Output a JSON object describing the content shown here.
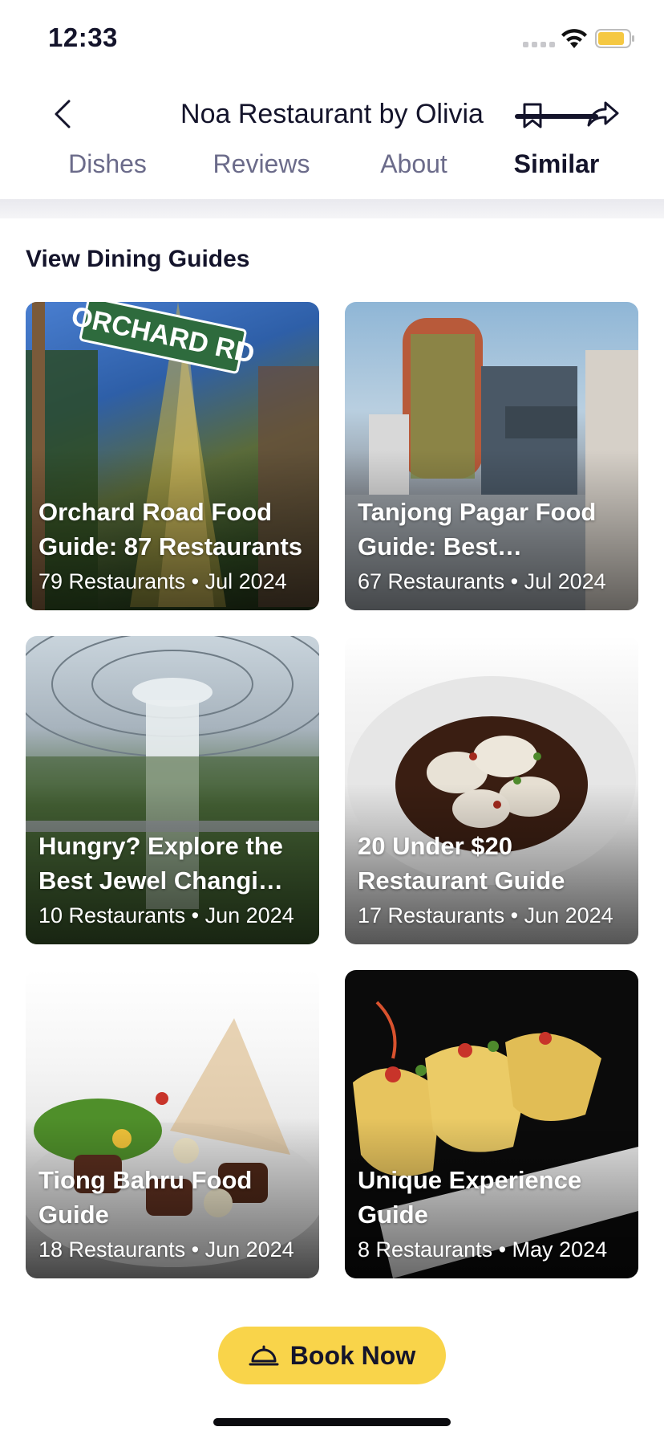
{
  "status_bar": {
    "time": "12:33"
  },
  "header": {
    "title": "Noa Restaurant by Olivia",
    "tabs": [
      {
        "label": "Dishes",
        "active": false
      },
      {
        "label": "Reviews",
        "active": false
      },
      {
        "label": "About",
        "active": false
      },
      {
        "label": "Similar",
        "active": true
      }
    ]
  },
  "section": {
    "title": "View Dining Guides",
    "guides": [
      {
        "title": "Orchard Road Food Guide: 87 Restaurants",
        "meta": "79 Restaurants • Jul 2024"
      },
      {
        "title": "Tanjong Pagar Food Guide: Best Restaurants",
        "meta": "67 Restaurants • Jul 2024"
      },
      {
        "title": "Hungry? Explore the Best Jewel Changi Restaurants",
        "meta": "10 Restaurants • Jun 2024"
      },
      {
        "title": "20 Under $20 Restaurant Guide",
        "meta": "17 Restaurants • Jun 2024"
      },
      {
        "title": "Tiong Bahru Food Guide",
        "meta": "18 Restaurants • Jun 2024"
      },
      {
        "title": "Unique Experience Guide",
        "meta": "8 Restaurants • May 2024"
      }
    ]
  },
  "footer": {
    "book_label": "Book Now"
  },
  "colors": {
    "accent": "#f9d44a",
    "text": "#14142b",
    "tab_inactive": "#6b6b8a"
  }
}
